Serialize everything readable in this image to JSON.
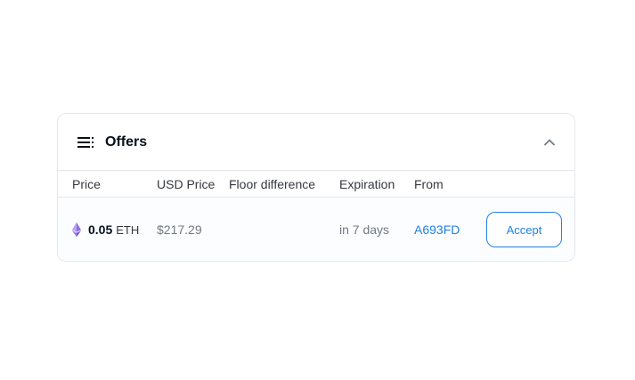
{
  "panel": {
    "title": "Offers",
    "icons": {
      "header": "list-icon",
      "collapse": "chevron-up-icon",
      "currency": "ethereum-icon"
    }
  },
  "columns": {
    "price": "Price",
    "usd_price": "USD Price",
    "floor_difference": "Floor difference",
    "expiration": "Expiration",
    "from": "From"
  },
  "offers": [
    {
      "amount": "0.05",
      "currency": "ETH",
      "usd_price": "$217.29",
      "floor_difference": "",
      "expiration": "in 7 days",
      "from": "A693FD",
      "action_label": "Accept"
    }
  ],
  "colors": {
    "accent": "#2081e2",
    "eth": "#7b5cd6",
    "border": "#e5e8eb"
  }
}
